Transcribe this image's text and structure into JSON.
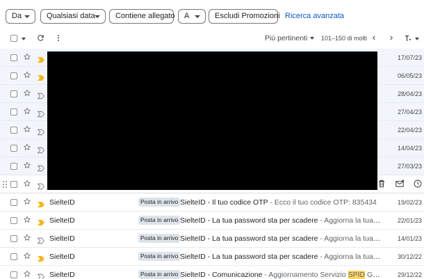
{
  "filters": {
    "from": "Da",
    "any_date": "Qualsiasi data",
    "has_attachment": "Contiene allegato",
    "to": "A",
    "exclude_promotions": "Escludi Promozioni",
    "advanced_search": "Ricerca avanzata"
  },
  "toolbar": {
    "sort": "Più pertinenti",
    "pagination": "101–150 di molti"
  },
  "rows": [
    {
      "date": "17/07/23",
      "important": true
    },
    {
      "date": "06/05/23",
      "important": true
    },
    {
      "date": "28/04/23",
      "important": false
    },
    {
      "date": "27/04/23",
      "important": false
    },
    {
      "date": "22/04/23",
      "important": false
    },
    {
      "date": "14/04/23",
      "important": false
    },
    {
      "date": "27/03/23",
      "important": false
    },
    {
      "date": "",
      "important": false
    },
    {
      "sender": "SielteID",
      "label": "Posta in arrivo",
      "subject": "SielteID - Il tuo codice OTP",
      "snippet": " - Ecco il tuo codice OTP: 835434",
      "date": "19/02/23",
      "important": true
    },
    {
      "sender": "SielteID",
      "label": "Posta in arrivo",
      "subject": "SielteID - La tua password sta per scadere",
      "snippet": " - Aggiorna la tua passwor...",
      "date": "22/01/23",
      "important": true
    },
    {
      "sender": "SielteID",
      "label": "Posta in arrivo",
      "subject": "SielteID - La tua password sta per scadere",
      "snippet": " - Aggiorna la tua passwor...",
      "date": "14/01/23",
      "important": false
    },
    {
      "sender": "SielteID",
      "label": "Posta in arrivo",
      "subject": "SielteID - La tua password sta per scadere",
      "snippet": " - Aggiorna la tua passwor...",
      "date": "30/12/22",
      "important": true
    },
    {
      "sender": "SielteID",
      "label": "Posta in arrivo",
      "subject": "SielteID - Comunicazione",
      "snippet_pre": " - Aggiornamento Servizio ",
      "snippet_hl": "SPID",
      "snippet_post": " Gentile Ale...",
      "date": "29/12/22",
      "important": false
    }
  ],
  "colors": {
    "accent": "#0b57d0",
    "important_marker": "#f2b81c",
    "highlight": "#fdd663"
  },
  "icons": {
    "select_all": "checkbox-icon",
    "refresh": "refresh-icon",
    "more": "more-vert-icon",
    "prev": "chevron-left-icon",
    "next": "chevron-right-icon",
    "density": "input-tools-icon",
    "star": "star-icon",
    "important": "label-important-icon",
    "delete": "trash-icon",
    "mark_unread": "mail-icon",
    "snooze": "clock-icon",
    "drag": "drag-handle-icon"
  }
}
